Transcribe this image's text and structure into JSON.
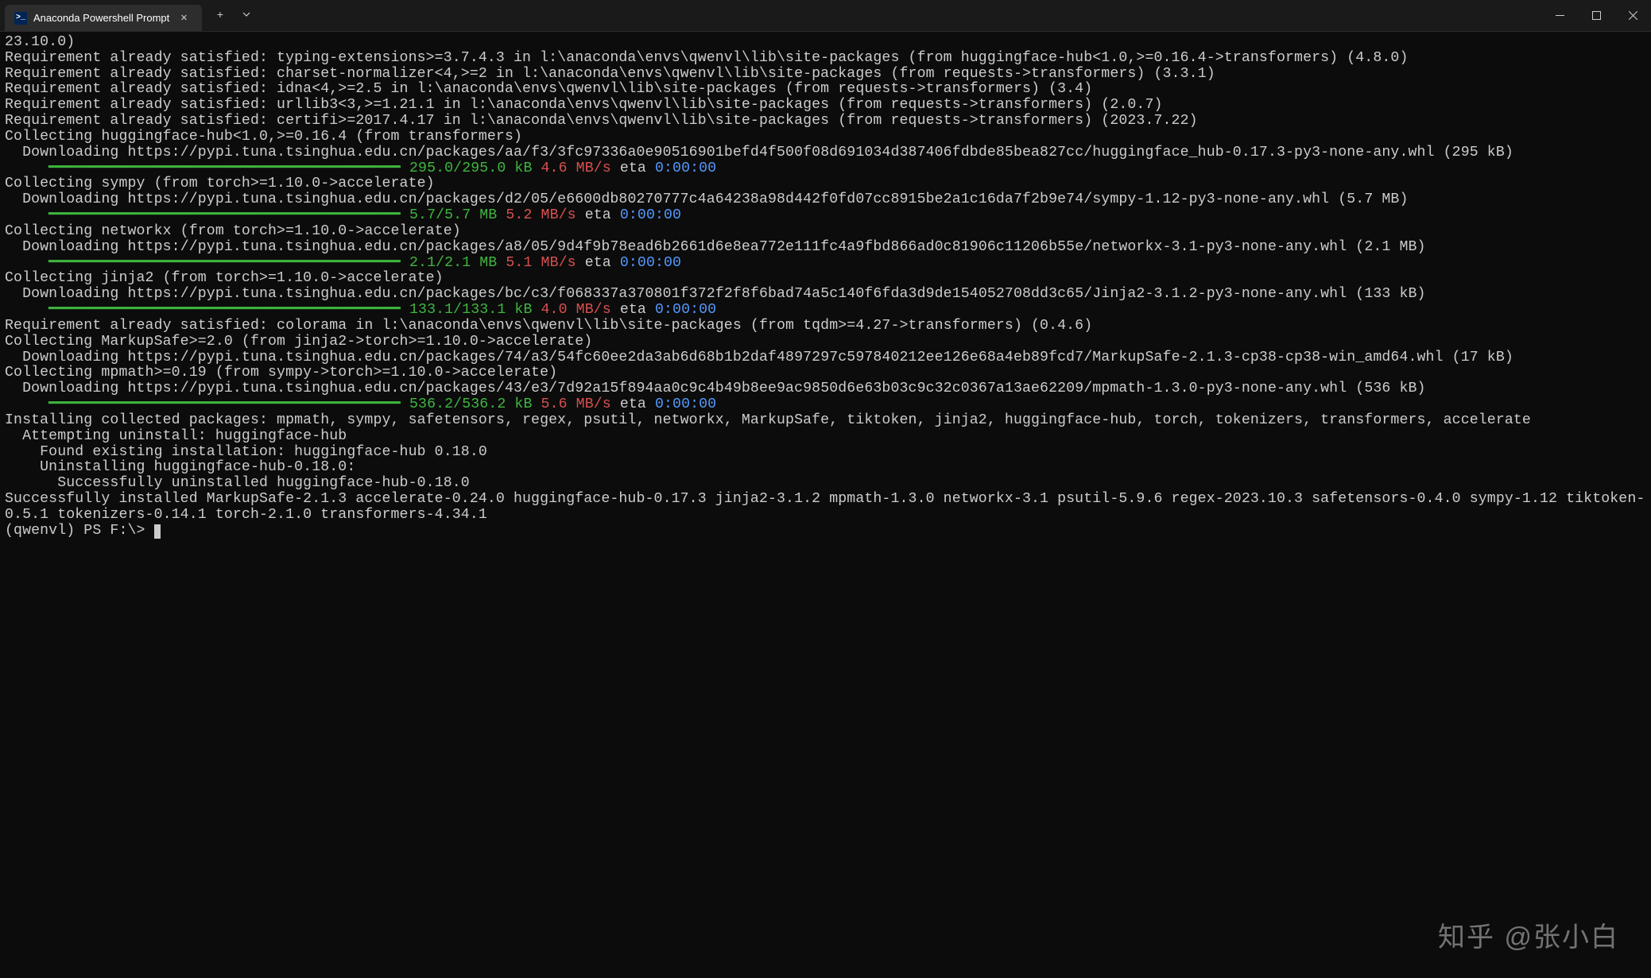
{
  "window": {
    "tab_title": "Anaconda Powershell Prompt",
    "tab_icon_text": ">_"
  },
  "terminal_lines": [
    "23.10.0)",
    "Requirement already satisfied: typing-extensions>=3.7.4.3 in l:\\anaconda\\envs\\qwenvl\\lib\\site-packages (from huggingface-hub<1.0,>=0.16.4->transformers) (4.8.0)",
    "Requirement already satisfied: charset-normalizer<4,>=2 in l:\\anaconda\\envs\\qwenvl\\lib\\site-packages (from requests->transformers) (3.3.1)",
    "Requirement already satisfied: idna<4,>=2.5 in l:\\anaconda\\envs\\qwenvl\\lib\\site-packages (from requests->transformers) (3.4)",
    "Requirement already satisfied: urllib3<3,>=1.21.1 in l:\\anaconda\\envs\\qwenvl\\lib\\site-packages (from requests->transformers) (2.0.7)",
    "Requirement already satisfied: certifi>=2017.4.17 in l:\\anaconda\\envs\\qwenvl\\lib\\site-packages (from requests->transformers) (2023.7.22)",
    "Collecting huggingface-hub<1.0,>=0.16.4 (from transformers)",
    "  Downloading https://pypi.tuna.tsinghua.edu.cn/packages/aa/f3/3fc97336a0e90516901befd4f500f08d691034d387406fdbde85bea827cc/huggingface_hub-0.17.3-py3-none-any.whl (295 kB)"
  ],
  "progress_items": [
    {
      "bar": "     ━━━━━━━━━━━━━━━━━━━━━━━━━━━━━━━━━━━━━━━━",
      "size": "295.0/295.0 kB",
      "speed": "4.6 MB/s",
      "eta_label": "eta",
      "eta": "0:00:00"
    }
  ],
  "lines2": [
    "Collecting sympy (from torch>=1.10.0->accelerate)",
    "  Downloading https://pypi.tuna.tsinghua.edu.cn/packages/d2/05/e6600db80270777c4a64238a98d442f0fd07cc8915be2a1c16da7f2b9e74/sympy-1.12-py3-none-any.whl (5.7 MB)"
  ],
  "progress_items2": [
    {
      "bar": "     ━━━━━━━━━━━━━━━━━━━━━━━━━━━━━━━━━━━━━━━━",
      "size": "5.7/5.7 MB",
      "speed": "5.2 MB/s",
      "eta_label": "eta",
      "eta": "0:00:00"
    }
  ],
  "lines3": [
    "Collecting networkx (from torch>=1.10.0->accelerate)",
    "  Downloading https://pypi.tuna.tsinghua.edu.cn/packages/a8/05/9d4f9b78ead6b2661d6e8ea772e111fc4a9fbd866ad0c81906c11206b55e/networkx-3.1-py3-none-any.whl (2.1 MB)"
  ],
  "progress_items3": [
    {
      "bar": "     ━━━━━━━━━━━━━━━━━━━━━━━━━━━━━━━━━━━━━━━━",
      "size": "2.1/2.1 MB",
      "speed": "5.1 MB/s",
      "eta_label": "eta",
      "eta": "0:00:00"
    }
  ],
  "lines4": [
    "Collecting jinja2 (from torch>=1.10.0->accelerate)",
    "  Downloading https://pypi.tuna.tsinghua.edu.cn/packages/bc/c3/f068337a370801f372f2f8f6bad74a5c140f6fda3d9de154052708dd3c65/Jinja2-3.1.2-py3-none-any.whl (133 kB)"
  ],
  "progress_items4": [
    {
      "bar": "     ━━━━━━━━━━━━━━━━━━━━━━━━━━━━━━━━━━━━━━━━",
      "size": "133.1/133.1 kB",
      "speed": "4.0 MB/s",
      "eta_label": "eta",
      "eta": "0:00:00"
    }
  ],
  "lines5": [
    "Requirement already satisfied: colorama in l:\\anaconda\\envs\\qwenvl\\lib\\site-packages (from tqdm>=4.27->transformers) (0.4.6)",
    "Collecting MarkupSafe>=2.0 (from jinja2->torch>=1.10.0->accelerate)",
    "  Downloading https://pypi.tuna.tsinghua.edu.cn/packages/74/a3/54fc60ee2da3ab6d68b1b2daf4897297c597840212ee126e68a4eb89fcd7/MarkupSafe-2.1.3-cp38-cp38-win_amd64.whl (17 kB)",
    "Collecting mpmath>=0.19 (from sympy->torch>=1.10.0->accelerate)",
    "  Downloading https://pypi.tuna.tsinghua.edu.cn/packages/43/e3/7d92a15f894aa0c9c4b49b8ee9ac9850d6e63b03c9c32c0367a13ae62209/mpmath-1.3.0-py3-none-any.whl (536 kB)"
  ],
  "progress_items5": [
    {
      "bar": "     ━━━━━━━━━━━━━━━━━━━━━━━━━━━━━━━━━━━━━━━━",
      "size": "536.2/536.2 kB",
      "speed": "5.6 MB/s",
      "eta_label": "eta",
      "eta": "0:00:00"
    }
  ],
  "lines6": [
    "Installing collected packages: mpmath, sympy, safetensors, regex, psutil, networkx, MarkupSafe, tiktoken, jinja2, huggingface-hub, torch, tokenizers, transformers, accelerate",
    "  Attempting uninstall: huggingface-hub",
    "    Found existing installation: huggingface-hub 0.18.0",
    "    Uninstalling huggingface-hub-0.18.0:",
    "      Successfully uninstalled huggingface-hub-0.18.0",
    "Successfully installed MarkupSafe-2.1.3 accelerate-0.24.0 huggingface-hub-0.17.3 jinja2-3.1.2 mpmath-1.3.0 networkx-3.1 psutil-5.9.6 regex-2023.10.3 safetensors-0.4.0 sympy-1.12 tiktoken-0.5.1 tokenizers-0.14.1 torch-2.1.0 transformers-4.34.1"
  ],
  "prompt": "(qwenvl) PS F:\\> ",
  "watermark": "知乎 @张小白"
}
